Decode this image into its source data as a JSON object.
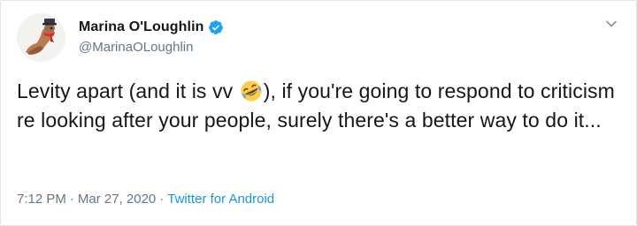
{
  "author": {
    "display_name": "Marina O'Loughlin",
    "handle": "@MarinaOLoughlin",
    "verified": true,
    "avatar_icon": "avatar-snail-illustration"
  },
  "tweet": {
    "text_before_emoji": "Levity apart (and it is vv ",
    "emoji": "rolling-on-floor-laughing-emoji",
    "text_after_emoji": "), if you're going to respond to criticism re looking after your people, surely there's a better way to do it..."
  },
  "footer": {
    "time": "7:12 PM",
    "separator": "·",
    "date": "Mar 27, 2020",
    "source": "Twitter for Android"
  },
  "colors": {
    "accent": "#1da1f2",
    "link": "#1b95e0",
    "muted": "#657786",
    "text": "#14171a"
  },
  "icons": {
    "verified": "verified-badge-icon",
    "menu": "chevron-down-icon"
  }
}
